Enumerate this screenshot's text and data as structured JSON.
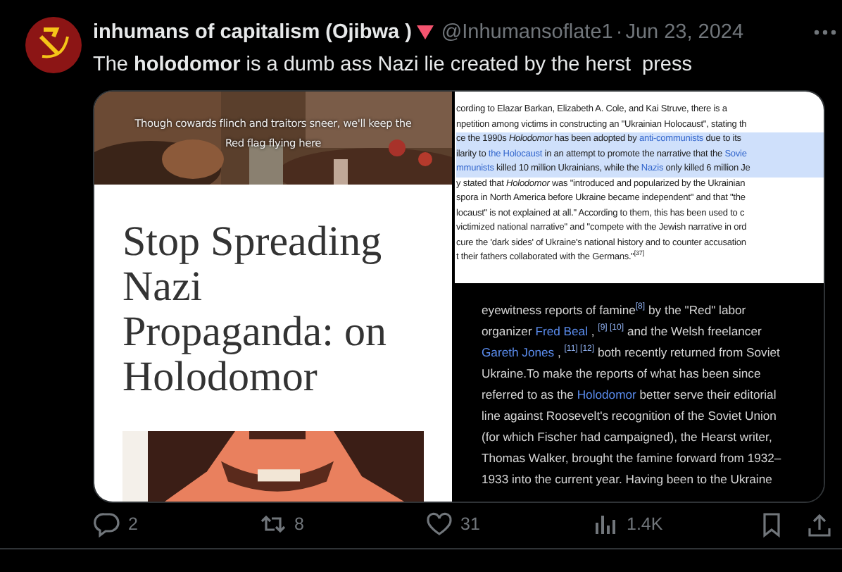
{
  "tweet": {
    "author": {
      "name": "inhumans of capitalism (Ojibwa )",
      "handle": "@Inhumansoflate1",
      "separator": "·",
      "date": "Jun 23, 2024"
    },
    "text": "The **holodomor** is a dumb ass Nazi lie created by the herst  press",
    "media": [
      {
        "kind": "blog",
        "tagline": "Though cowards flinch and traitors sneer, we'll keep the Red flag flying here",
        "title": "Stop Spreading Nazi Propaganda: on Holodomor"
      },
      {
        "kind": "wiki",
        "excerpts": [
          {
            "kind": "light",
            "lines": [
              {
                "highlighted": false,
                "segments": [
                  {
                    "kind": "text",
                    "text": "cording to Elazar Barkan, Elizabeth A. Cole, and Kai Struve, there is a"
                  }
                ]
              },
              {
                "highlighted": false,
                "segments": [
                  {
                    "kind": "text",
                    "text": "npetition among victims in constructing an \"Ukrainian Holocaust\", stating th"
                  }
                ]
              },
              {
                "highlighted": true,
                "segments": [
                  {
                    "kind": "text",
                    "text": "ce the 1990s *Holodomor* has been adopted by"
                  },
                  {
                    "kind": "link",
                    "text": "anti-communists"
                  },
                  {
                    "kind": "text",
                    "text": "due to its"
                  }
                ]
              },
              {
                "highlighted": true,
                "segments": [
                  {
                    "kind": "text",
                    "text": "ilarity to"
                  },
                  {
                    "kind": "link",
                    "text": "the Holocaust"
                  },
                  {
                    "kind": "text",
                    "text": "in an attempt to promote the narrative that the"
                  },
                  {
                    "kind": "link",
                    "text": "Sovie"
                  }
                ]
              },
              {
                "highlighted": true,
                "segments": [
                  {
                    "kind": "link",
                    "text": "mmunists"
                  },
                  {
                    "kind": "text",
                    "text": "killed 10 million Ukrainians, while the"
                  },
                  {
                    "kind": "link",
                    "text": "Nazis"
                  },
                  {
                    "kind": "text",
                    "text": "only killed 6 million Je"
                  }
                ]
              },
              {
                "highlighted": false,
                "segments": [
                  {
                    "kind": "text",
                    "text": "y stated that *Holodomor* was \"introduced and popularized by the Ukrainian"
                  }
                ]
              },
              {
                "highlighted": false,
                "segments": [
                  {
                    "kind": "text",
                    "text": "spora in North America before Ukraine became independent\" and that \"the"
                  }
                ]
              },
              {
                "highlighted": false,
                "segments": [
                  {
                    "kind": "text",
                    "text": "locaust\" is not explained at all.\" According to them, this has been used to c"
                  }
                ]
              },
              {
                "highlighted": false,
                "segments": [
                  {
                    "kind": "text",
                    "text": "victimized national narrative\" and \"compete with the Jewish narrative in ord"
                  }
                ]
              },
              {
                "highlighted": false,
                "segments": [
                  {
                    "kind": "text",
                    "text": "cure the 'dark sides' of Ukraine's national history and to counter accusation"
                  }
                ]
              },
              {
                "highlighted": false,
                "segments": [
                  {
                    "kind": "text",
                    "text": "t their fathers collaborated with the Germans.\"$^{[37]}$"
                  }
                ]
              }
            ]
          },
          {
            "kind": "dark",
            "lines": [
              {
                "highlighted": false,
                "segments": [
                  {
                    "kind": "text",
                    "text": "eyewitness reports of famine$^{[8]}$ by the \"Red\" labor"
                  }
                ]
              },
              {
                "highlighted": false,
                "segments": [
                  {
                    "kind": "text",
                    "text": "organizer"
                  },
                  {
                    "kind": "link",
                    "text": "Fred Beal"
                  },
                  {
                    "kind": "text",
                    "text": ", $^{[9] [10]}$ and the Welsh freelancer"
                  }
                ]
              },
              {
                "highlighted": false,
                "segments": [
                  {
                    "kind": "link",
                    "text": "Gareth Jones"
                  },
                  {
                    "kind": "text",
                    "text": ", $^{[11] [12]}$ both recently returned from Soviet"
                  }
                ]
              },
              {
                "highlighted": false,
                "segments": [
                  {
                    "kind": "text",
                    "text": "Ukraine.To make the reports of what has been since"
                  }
                ]
              },
              {
                "highlighted": false,
                "segments": [
                  {
                    "kind": "text",
                    "text": "referred to as the"
                  },
                  {
                    "kind": "link",
                    "text": "Holodomor"
                  },
                  {
                    "kind": "text",
                    "text": "better serve their editorial"
                  }
                ]
              },
              {
                "highlighted": false,
                "segments": [
                  {
                    "kind": "text",
                    "text": "line against Roosevelt's recognition of the Soviet Union"
                  }
                ]
              },
              {
                "highlighted": false,
                "segments": [
                  {
                    "kind": "text",
                    "text": "(for which Fischer had campaigned), the Hearst writer,"
                  }
                ]
              },
              {
                "highlighted": false,
                "segments": [
                  {
                    "kind": "text",
                    "text": "Thomas Walker, brought the famine forward from 1932–"
                  }
                ]
              },
              {
                "highlighted": false,
                "segments": [
                  {
                    "kind": "text",
                    "text": "1933 into the current year. Having been to the Ukraine"
                  }
                ]
              }
            ]
          }
        ]
      }
    ],
    "actions": [
      {
        "kind": "reply",
        "count": "2"
      },
      {
        "kind": "repost",
        "count": "8"
      },
      {
        "kind": "like",
        "count": "31"
      },
      {
        "kind": "views",
        "count": "1.4K"
      },
      {
        "kind": "bookmark"
      },
      {
        "kind": "share"
      }
    ]
  }
}
